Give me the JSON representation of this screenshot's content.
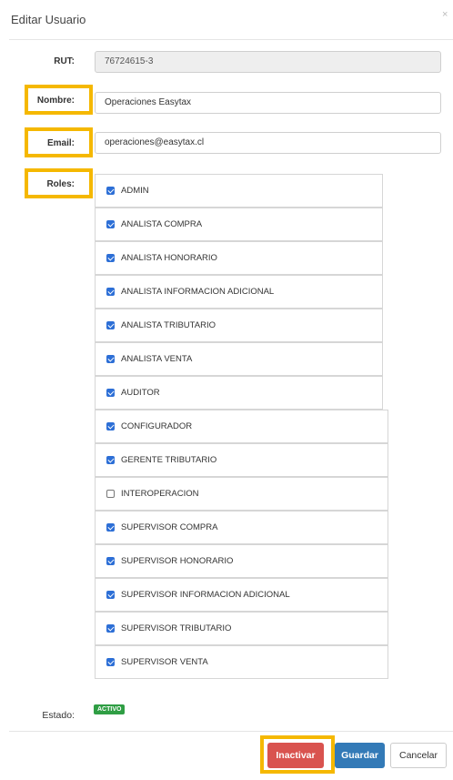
{
  "dialog": {
    "title": "Editar Usuario",
    "close": "×"
  },
  "form": {
    "rut": {
      "label": "RUT:",
      "value": "76724615-3"
    },
    "nombre": {
      "label": "Nombre:",
      "value": "Operaciones Easytax"
    },
    "email": {
      "label": "Email:",
      "value": "operaciones@easytax.cl"
    },
    "roles_label": "Roles:",
    "roles": [
      {
        "label": "ADMIN",
        "checked": true
      },
      {
        "label": "ANALISTA COMPRA",
        "checked": true
      },
      {
        "label": "ANALISTA HONORARIO",
        "checked": true
      },
      {
        "label": "ANALISTA INFORMACION ADICIONAL",
        "checked": true
      },
      {
        "label": "ANALISTA TRIBUTARIO",
        "checked": true
      },
      {
        "label": "ANALISTA VENTA",
        "checked": true
      },
      {
        "label": "AUDITOR",
        "checked": true
      },
      {
        "label": "CONFIGURADOR",
        "checked": true
      },
      {
        "label": "GERENTE TRIBUTARIO",
        "checked": true
      },
      {
        "label": "INTEROPERACION",
        "checked": false
      },
      {
        "label": "SUPERVISOR COMPRA",
        "checked": true
      },
      {
        "label": "SUPERVISOR HONORARIO",
        "checked": true
      },
      {
        "label": "SUPERVISOR INFORMACION ADICIONAL",
        "checked": true
      },
      {
        "label": "SUPERVISOR TRIBUTARIO",
        "checked": true
      },
      {
        "label": "SUPERVISOR VENTA",
        "checked": true
      }
    ],
    "estado": {
      "label": "Estado:",
      "value": "ACTIVO",
      "color": "#2f9e44"
    }
  },
  "footer": {
    "inactivar": "Inactivar",
    "guardar": "Guardar",
    "cancelar": "Cancelar"
  },
  "colors": {
    "highlight": "#f5b800",
    "danger": "#d9534f",
    "primary": "#337ab7",
    "checkbox": "#2d6fd6"
  }
}
